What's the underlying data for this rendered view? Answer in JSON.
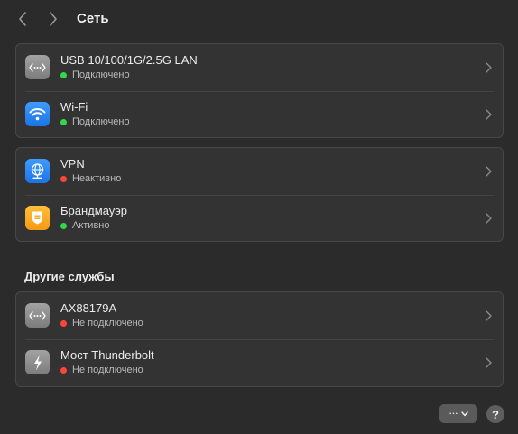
{
  "header": {
    "title": "Сеть",
    "back_icon": "chevron-left-icon",
    "forward_icon": "chevron-right-icon"
  },
  "groups": [
    {
      "items": [
        {
          "title": "USB 10/100/1G/2.5G LAN",
          "status": "Подключено",
          "status_color": "#32d74b",
          "icon": "ethernet-icon"
        },
        {
          "title": "Wi-Fi",
          "status": "Подключено",
          "status_color": "#32d74b",
          "icon": "wifi-icon"
        }
      ]
    },
    {
      "items": [
        {
          "title": "VPN",
          "status": "Неактивно",
          "status_color": "#ff453a",
          "icon": "globe-icon"
        },
        {
          "title": "Брандмауэр",
          "status": "Активно",
          "status_color": "#32d74b",
          "icon": "firewall-shield-icon"
        }
      ]
    }
  ],
  "other_services": {
    "heading": "Другие службы",
    "items": [
      {
        "title": "AX88179A",
        "status": "Не подключено",
        "status_color": "#ff453a",
        "icon": "ethernet-icon"
      },
      {
        "title": "Мост Thunderbolt",
        "status": "Не подключено",
        "status_color": "#ff453a",
        "icon": "thunderbolt-icon"
      }
    ]
  },
  "footer": {
    "more_label": "···",
    "help_label": "?"
  },
  "colors": {
    "background": "#2b2b2b",
    "group_background": "#333333",
    "connected": "#32d74b",
    "disconnected": "#ff453a"
  }
}
